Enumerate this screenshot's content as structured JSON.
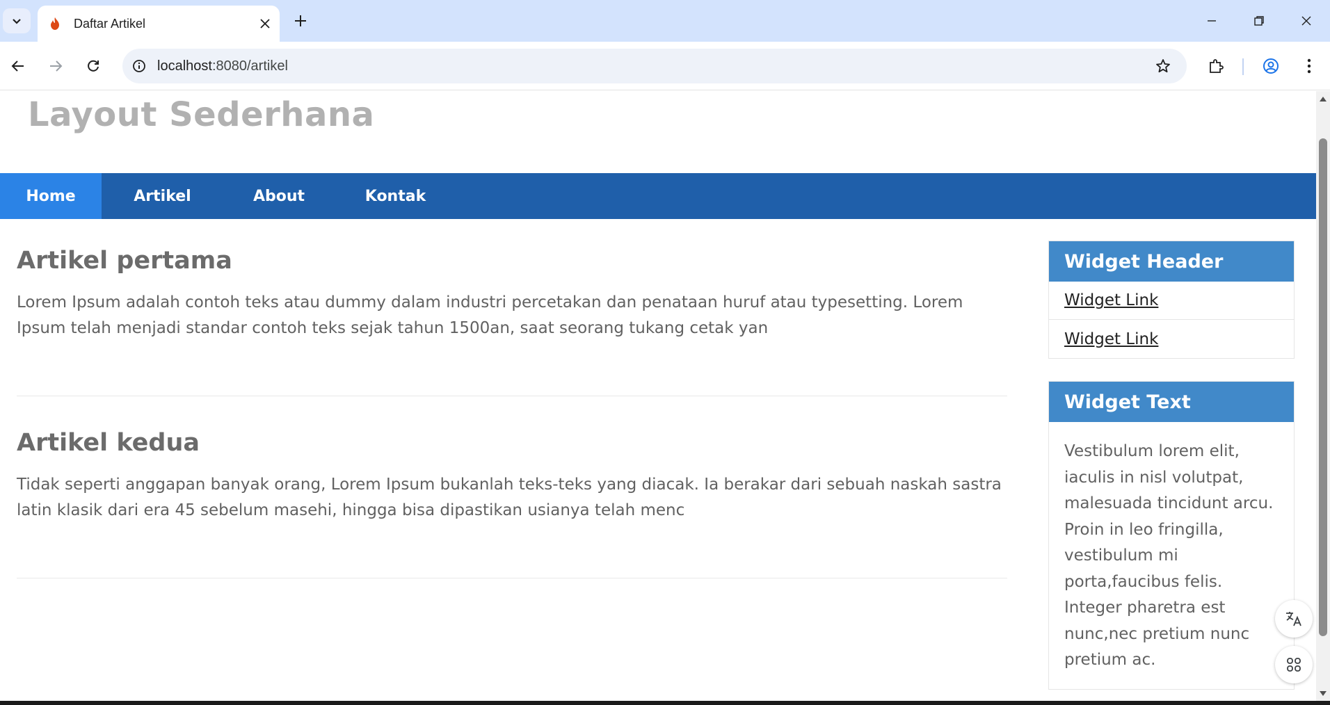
{
  "browser": {
    "tab_title": "Daftar Artikel",
    "url_host": "localhost",
    "url_path": ":8080/artikel",
    "icons": [
      "tab-search-icon",
      "fire-favicon-icon",
      "close-icon",
      "plus-icon",
      "minimize-icon",
      "restore-icon",
      "window-close-icon",
      "back-icon",
      "forward-icon",
      "reload-icon",
      "site-info-icon",
      "star-icon",
      "extensions-icon",
      "profile-icon",
      "menu-dots-icon"
    ]
  },
  "page": {
    "site_title": "Layout Sederhana",
    "nav": [
      {
        "label": "Home",
        "active": true
      },
      {
        "label": "Artikel",
        "active": false
      },
      {
        "label": "About",
        "active": false
      },
      {
        "label": "Kontak",
        "active": false
      }
    ],
    "articles": [
      {
        "title": "Artikel pertama",
        "body": "Lorem Ipsum adalah contoh teks atau dummy dalam industri percetakan dan penataan huruf atau typesetting. Lorem Ipsum telah menjadi standar contoh teks sejak tahun 1500an, saat seorang tukang cetak yan"
      },
      {
        "title": "Artikel kedua",
        "body": "Tidak seperti anggapan banyak orang, Lorem Ipsum bukanlah teks-teks yang diacak. Ia berakar dari sebuah naskah sastra latin klasik dari era 45 sebelum masehi, hingga bisa dipastikan usianya telah menc"
      }
    ],
    "sidebar": {
      "widget1_header": "Widget Header",
      "links": [
        "Widget Link",
        "Widget Link"
      ],
      "widget2_header": "Widget Text",
      "widget2_text": "Vestibulum lorem elit, iaculis in nisl volutpat, malesuada tincidunt arcu. Proin in leo fringilla, vestibulum mi porta,faucibus felis. Integer pharetra est nunc,nec pretium nunc pretium ac."
    }
  },
  "colors": {
    "tabstrip": "#d3e3fd",
    "navbar": "#1f5faa",
    "nav_active": "#2b83e6",
    "widget_header": "#4189c9",
    "title": "#b1b1b1"
  }
}
